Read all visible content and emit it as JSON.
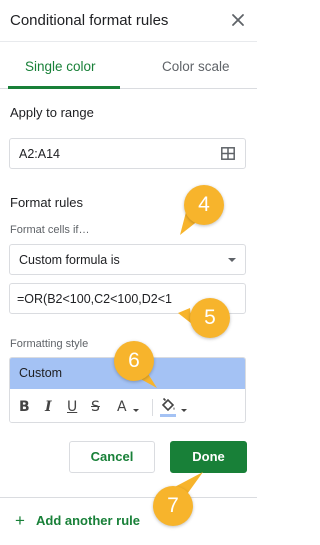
{
  "header": {
    "title": "Conditional format rules",
    "close_icon": "close-icon"
  },
  "tabs": [
    {
      "label": "Single color",
      "selected": true
    },
    {
      "label": "Color scale",
      "selected": false
    }
  ],
  "apply_range": {
    "label": "Apply to range",
    "value": "A2:A14",
    "icon": "grid-select-icon"
  },
  "format_rules": {
    "label": "Format rules",
    "condition_label": "Format cells if…",
    "condition_value": "Custom formula is",
    "formula_value": "=OR(B2<100,C2<100,D2<1"
  },
  "formatting_style": {
    "label": "Formatting style",
    "preview_text": "Custom",
    "preview_color": "#a4c2f4",
    "toolbar": {
      "bold": "B",
      "italic": "I",
      "underline": "U",
      "strikethrough": "S",
      "text_color": "A"
    }
  },
  "buttons": {
    "cancel": "Cancel",
    "done": "Done"
  },
  "footer": {
    "add_label": "Add another rule"
  },
  "annotations": [
    "4",
    "5",
    "6",
    "7"
  ],
  "colors": {
    "accent": "#188038",
    "badge": "#f7b42c",
    "preview": "#a4c2f4"
  }
}
